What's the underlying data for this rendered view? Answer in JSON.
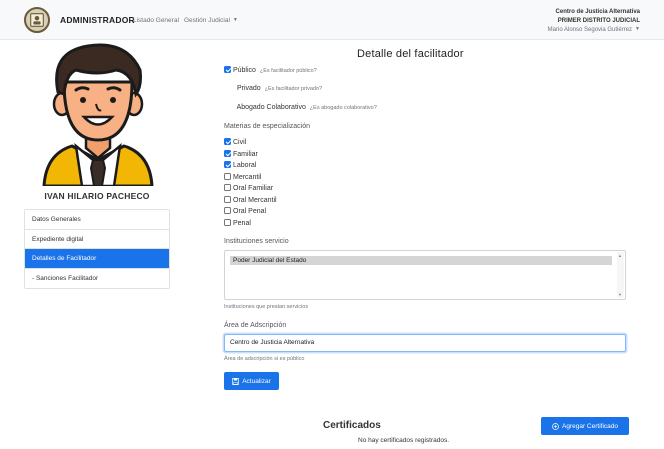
{
  "navbar": {
    "brand": "ADMINISTRADOR",
    "links": [
      {
        "label": "Listado General"
      },
      {
        "label": "Gestión Judicial",
        "has_caret": true
      }
    ],
    "user": {
      "organization": "Centro de Justicia Alternativa",
      "district": "PRIMER DISTRITO JUDICIAL",
      "name": "Mario Alonso Segovia Gutiérrez"
    }
  },
  "sidebar": {
    "profile_name": "IVAN HILARIO PACHECO",
    "items": [
      {
        "label": "Datos Generales",
        "active": false
      },
      {
        "label": "Expediente digital",
        "active": false
      },
      {
        "label": "Detalles de Facilitador",
        "active": true
      },
      {
        "label": "- Sanciones Facilitador",
        "active": false
      }
    ]
  },
  "main": {
    "title": "Detalle del facilitador",
    "options": [
      {
        "label": "Público",
        "hint": "¿Es facilitador público?",
        "checked": true
      },
      {
        "label": "Privado",
        "hint": "¿Es facilitador privado?",
        "checked": false
      },
      {
        "label": "Abogado Colaborativo",
        "hint": "¿Es abogado colaborativo?",
        "checked": false
      }
    ],
    "materias_label": "Materias de especialización",
    "materias": [
      {
        "label": "Civil",
        "checked": true
      },
      {
        "label": "Familiar",
        "checked": true
      },
      {
        "label": "Laboral",
        "checked": true
      },
      {
        "label": "Mercantil",
        "checked": false
      },
      {
        "label": "Oral Familiar",
        "checked": false
      },
      {
        "label": "Oral Mercantil",
        "checked": false
      },
      {
        "label": "Oral Penal",
        "checked": false
      },
      {
        "label": "Penal",
        "checked": false
      }
    ],
    "instituciones_label": "Instituciones servicio",
    "instituciones_selected": "Poder Judicial del Estado",
    "instituciones_help": "Instituciones que prestan servicios",
    "area_label": "Área de Adscripción",
    "area_value": "Centro de Justicia Alternativa",
    "area_help": "Área de adscripción si es público",
    "update_button": "Actualizar"
  },
  "certificados": {
    "title": "Certificados",
    "empty_text": "No hay certificados registrados.",
    "add_button": "Agregar Certificado"
  },
  "colors": {
    "primary": "#1a73e8",
    "navbar_bg": "#f8f9fa"
  }
}
